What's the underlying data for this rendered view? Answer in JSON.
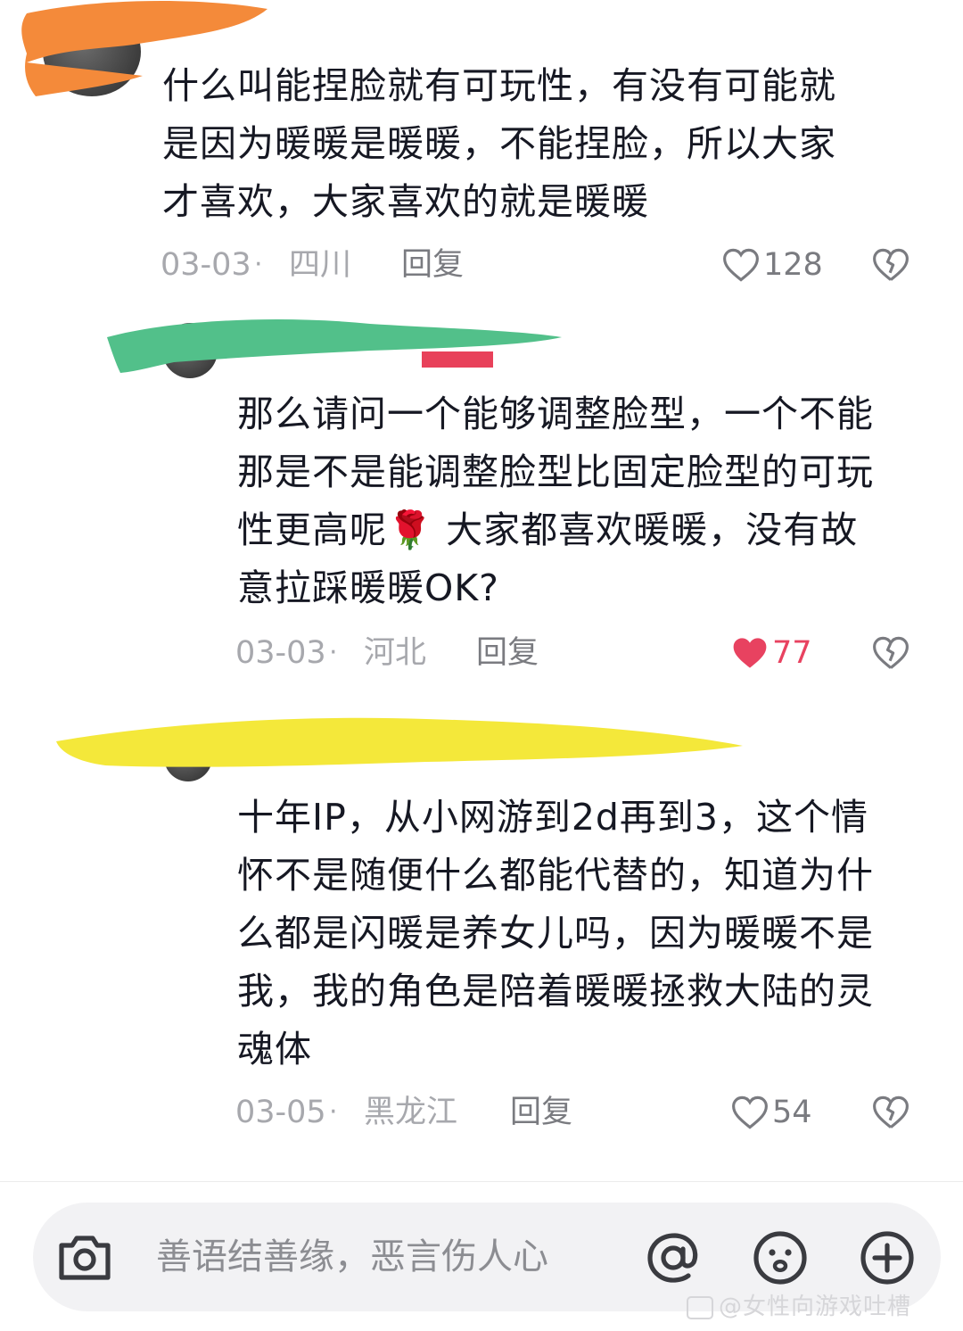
{
  "comments": [
    {
      "text": "什么叫能捏脸就有可玩性，有没有可能就\n是因为暖暖是暖暖，不能捏脸，所以大家\n才喜欢，大家喜欢的就是暖暖",
      "date": "03-03",
      "separator": "·",
      "location": "四川",
      "reply_label": "回复",
      "like_count": "128",
      "liked": false,
      "redaction_color": "#f48a3a"
    },
    {
      "text": "那么请问一个能够调整脸型，一个不能\n那是不是能调整脸型比固定脸型的可玩\n性更高呢🌹 大家都喜欢暖暖，没有故\n意拉踩暖暖OK?",
      "date": "03-03",
      "separator": "·",
      "location": "河北",
      "reply_label": "回复",
      "like_count": "77",
      "liked": true,
      "redaction_color": "#52c08a"
    },
    {
      "text": "十年IP，从小网游到2d再到3，这个情\n怀不是随便什么都能代替的，知道为什\n么都是闪暖是养女儿吗，因为暖暖不是\n我，我的角色是陪着暖暖拯救大陆的灵\n魂体",
      "date": "03-05",
      "separator": "·",
      "location": "黑龙江",
      "reply_label": "回复",
      "like_count": "54",
      "liked": false,
      "redaction_color": "#f4e83a"
    }
  ],
  "composer": {
    "placeholder": "善语结善缘，恶言伤人心",
    "icons": [
      "camera-icon",
      "mention-icon",
      "emoji-icon",
      "plus-icon"
    ]
  },
  "watermark": "@女性向游戏吐槽"
}
